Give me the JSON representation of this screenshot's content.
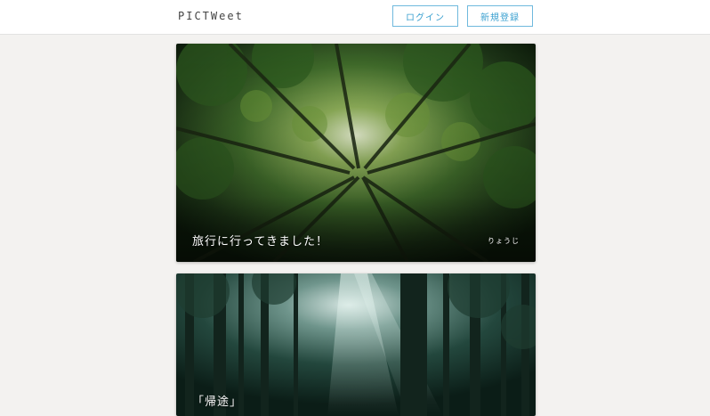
{
  "header": {
    "logo": "PICTWeet",
    "login_label": "ログイン",
    "signup_label": "新規登録"
  },
  "posts": [
    {
      "title": "旅行に行ってきました！",
      "author": "りょうじ",
      "image": "forest-canopy-photo"
    },
    {
      "title": "「帰途」",
      "author": "",
      "image": "forest-light-rays-photo"
    }
  ],
  "colors": {
    "accent": "#3aa0d0",
    "background": "#f3f2f0"
  }
}
